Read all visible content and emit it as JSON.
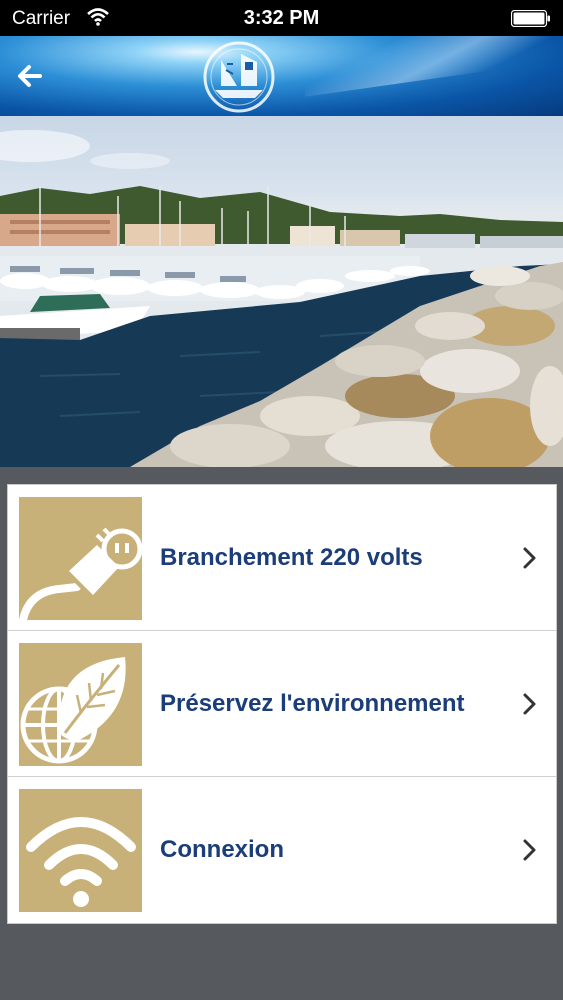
{
  "status_bar": {
    "carrier": "Carrier",
    "time": "3:32 PM",
    "wifi_icon": "wifi-icon",
    "battery_icon": "battery-icon"
  },
  "header": {
    "back_icon": "back-arrow-icon",
    "logo": "harbor-logo-sailboat"
  },
  "hero": {
    "image": "marina-photo"
  },
  "menu": {
    "items": [
      {
        "label": "Branchement 220 volts",
        "icon": "electric-plug-icon"
      },
      {
        "label": "Préservez l'environnement",
        "icon": "leaf-globe-icon"
      },
      {
        "label": "Connexion",
        "icon": "wifi-icon"
      }
    ]
  },
  "colors": {
    "label": "#1b3d7a",
    "icon_bg": "#c8b079",
    "page_bg": "#56595d",
    "status_bg": "#000000"
  }
}
